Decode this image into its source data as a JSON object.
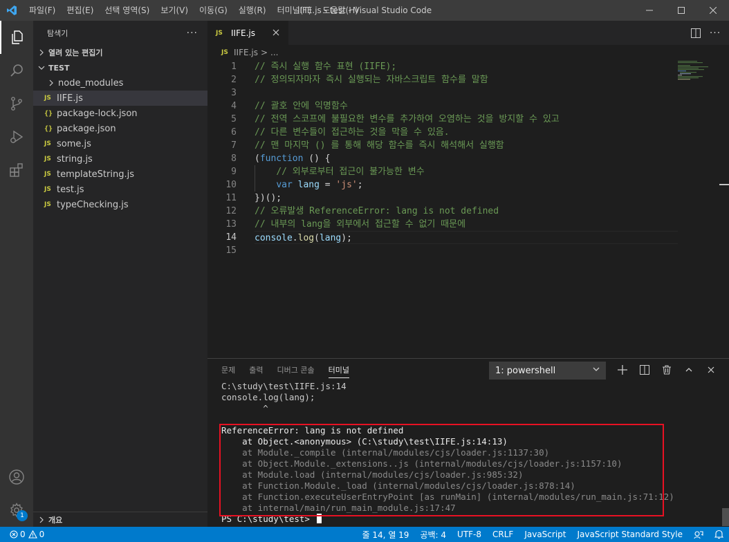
{
  "titlebar": {
    "menus": [
      "파일(F)",
      "편집(E)",
      "선택 영역(S)",
      "보기(V)",
      "이동(G)",
      "실행(R)",
      "터미널(T)",
      "도움말(H)"
    ],
    "title": "IIFE.js - test - Visual Studio Code"
  },
  "activitybar": {
    "icons": [
      "explorer-icon",
      "search-icon",
      "source-control-icon",
      "run-debug-icon",
      "extensions-icon"
    ],
    "bottom_icons": [
      "accounts-icon",
      "settings-gear-icon"
    ],
    "settings_badge": "1"
  },
  "sidebar": {
    "title": "탐색기",
    "more": "···",
    "open_editors": "열려 있는 편집기",
    "folder": "TEST",
    "files": [
      {
        "icon": "",
        "name": "node_modules"
      },
      {
        "icon": "JS",
        "name": "IIFE.js"
      },
      {
        "icon": "{}",
        "name": "package-lock.json"
      },
      {
        "icon": "{}",
        "name": "package.json"
      },
      {
        "icon": "JS",
        "name": "some.js"
      },
      {
        "icon": "JS",
        "name": "string.js"
      },
      {
        "icon": "JS",
        "name": "templateString.js"
      },
      {
        "icon": "JS",
        "name": "test.js"
      },
      {
        "icon": "JS",
        "name": "typeChecking.js"
      }
    ],
    "outline": "개요"
  },
  "editor": {
    "tab": {
      "icon": "JS",
      "label": "IIFE.js"
    },
    "breadcrumb": {
      "icon": "JS",
      "file": "IIFE.js",
      "sep": ">",
      "rest": "..."
    },
    "lines": [
      "1",
      "2",
      "3",
      "4",
      "5",
      "6",
      "7",
      "8",
      "9",
      "10",
      "11",
      "12",
      "13",
      "14",
      "15"
    ],
    "code": {
      "l1": "// 즉시 실행 함수 표현 (IIFE);",
      "l2": "// 정의되자마자 즉시 실행되는 자바스크립트 함수를 말함",
      "l4": "// 괄호 안에 익명함수",
      "l5": "// 전역 스코프에 불필요한 변수를 추가하여 오염하는 것을 방지할 수 있고",
      "l6": "// 다른 변수들이 접근하는 것을 막을 수 있음.",
      "l7": "// 맨 마지막 () 를 통해 해당 함수를 즉시 해석해서 실행함",
      "l8_open": "(",
      "l8_kw": "function",
      "l8_rest": " () {",
      "l9": "// 외부로부터 접근이 불가능한 변수",
      "l10_kw": "var",
      "l10_var": "lang",
      "l10_eq": " = ",
      "l10_str": "'js'",
      "l10_end": ";",
      "l11": "})();",
      "l12": "// 오류발생 ReferenceError: lang is not defined",
      "l13": "// 내부의 lang을 외부에서 접근할 수 없기 때문에",
      "l14_obj": "console",
      "l14_dot": ".",
      "l14_fn": "log",
      "l14_open": "(",
      "l14_arg": "lang",
      "l14_close": ");"
    }
  },
  "panel": {
    "tabs": [
      "문제",
      "출력",
      "디버그 콘솔",
      "터미널"
    ],
    "terminal_select": "1: powershell",
    "terminal_lines": [
      "C:\\study\\test\\IIFE.js:14",
      "console.log(lang);",
      "        ^",
      "",
      "ReferenceError: lang is not defined",
      "    at Object.<anonymous> (C:\\study\\test\\IIFE.js:14:13)",
      "    at Module._compile (internal/modules/cjs/loader.js:1137:30)",
      "    at Object.Module._extensions..js (internal/modules/cjs/loader.js:1157:10)",
      "    at Module.load (internal/modules/cjs/loader.js:985:32)",
      "    at Function.Module._load (internal/modules/cjs/loader.js:878:14)",
      "    at Function.executeUserEntryPoint [as runMain] (internal/modules/run_main.js:71:12)",
      "    at internal/main/run_main_module.js:17:47",
      "PS C:\\study\\test> "
    ]
  },
  "statusbar": {
    "errors": "0",
    "warnings": "0",
    "position": "줄 14, 열 19",
    "spaces": "공백: 4",
    "encoding": "UTF-8",
    "eol": "CRLF",
    "language": "JavaScript",
    "formatter": "JavaScript Standard Style"
  },
  "colors": {
    "accent": "#007acc",
    "error_box": "#e81123",
    "comment": "#6a9955",
    "keyword": "#569cd6"
  }
}
